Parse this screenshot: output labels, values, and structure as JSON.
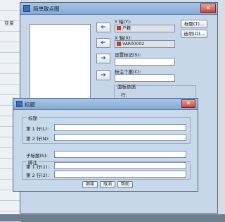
{
  "background": {
    "column_header": "变量"
  },
  "dialog": {
    "title": "简单散点图",
    "close_glyph": "✕",
    "y_axis_label": "Y 轴(Y):",
    "y_axis_value": "户籍",
    "x_axis_label": "X 轴(X):",
    "x_axis_value": "VAR00002",
    "set_marker_label": "设置标记(S):",
    "label_cases_label": "标注个案(C):",
    "panel_group_label": "面板依据",
    "panel_rows_label": "行:",
    "titles_button": "标题(T)...",
    "options_button": "选项(O)...",
    "arrow_glyph": "➔"
  },
  "titles_dialog": {
    "title": "标题",
    "close_glyph": "✕",
    "title_group": "标题",
    "line1_label": "第 1 行(L):",
    "line2_label": "第 2 行(N):",
    "subtitle_label": "子标题(S):",
    "footnote_group": "脚注",
    "footnote1_label": "第 1 行(1):",
    "footnote2_label": "第 2 行(2):",
    "continue_button": "继续",
    "cancel_button": "取消",
    "help_button": "帮助"
  },
  "colors": {
    "accent": "#86a9d3",
    "close": "#c6493b"
  }
}
